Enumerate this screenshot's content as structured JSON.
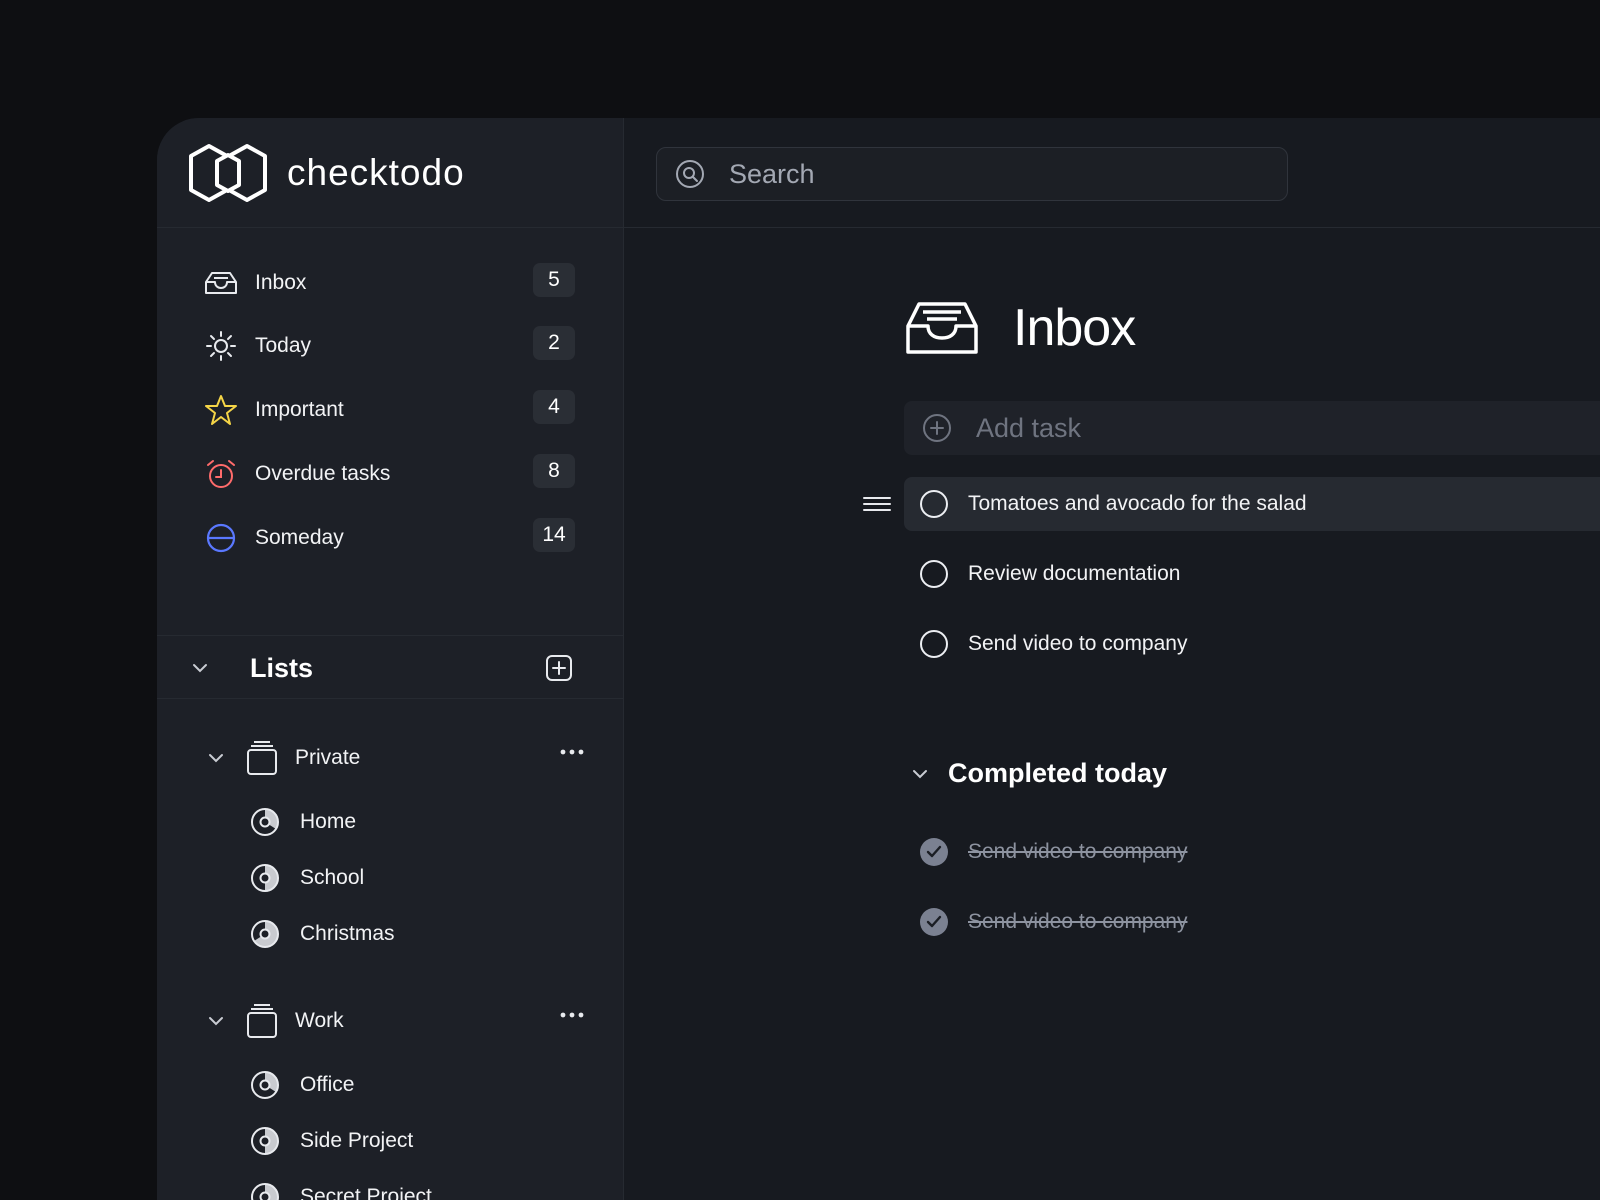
{
  "app": {
    "name": "checktodo"
  },
  "search": {
    "placeholder": "Search"
  },
  "nav": [
    {
      "label": "Inbox",
      "count": "5",
      "icon": "inbox-icon"
    },
    {
      "label": "Today",
      "count": "2",
      "icon": "sun-icon"
    },
    {
      "label": "Important",
      "count": "4",
      "icon": "star-icon"
    },
    {
      "label": "Overdue tasks",
      "count": "8",
      "icon": "alarm-clock-icon"
    },
    {
      "label": "Someday",
      "count": "14",
      "icon": "half-circle-icon"
    }
  ],
  "lists": {
    "title": "Lists",
    "groups": [
      {
        "label": "Private",
        "items": [
          "Home",
          "School",
          "Christmas"
        ]
      },
      {
        "label": "Work",
        "items": [
          "Office",
          "Side Project",
          "Secret Project"
        ]
      }
    ]
  },
  "main": {
    "title": "Inbox",
    "add_task_placeholder": "Add task",
    "tasks": [
      "Tomatoes and avocado for the salad",
      "Review documentation",
      "Send video to company"
    ],
    "completed_title": "Completed today",
    "completed": [
      "Send video to company",
      "Send video to company"
    ]
  },
  "colors": {
    "star": "#f5d547",
    "alarm": "#ff6b6b",
    "someday": "#5a78ff",
    "background": "#171a20",
    "sidebar": "#1d2027"
  }
}
